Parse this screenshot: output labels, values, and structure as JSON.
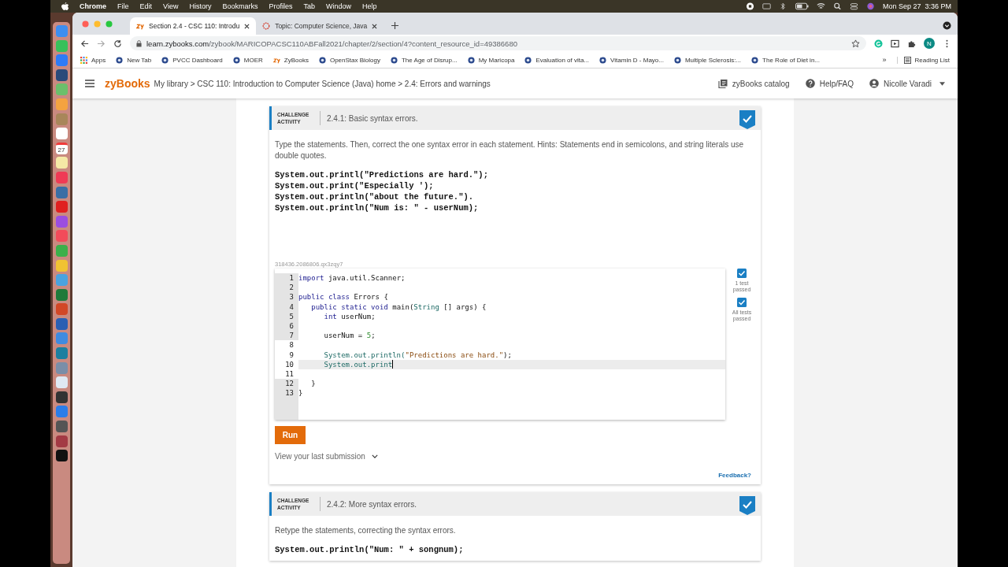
{
  "menubar": {
    "app": "Chrome",
    "menus": [
      "File",
      "Edit",
      "View",
      "History",
      "Bookmarks",
      "Profiles",
      "Tab",
      "Window",
      "Help"
    ],
    "clock": "Mon Sep 27  3:36 PM"
  },
  "dock": {
    "calendar_day": "27"
  },
  "tabs": [
    {
      "title": "Section 2.4 - CSC 110: Introdu",
      "selected": true,
      "kind": "zybooks"
    },
    {
      "title": "Topic: Computer Science, Java",
      "selected": false,
      "kind": "canvas"
    }
  ],
  "address": {
    "host": "learn.zybooks.com",
    "path": "/zybook/MARICOPACSC110ABFall2021/chapter/2/section/4?content_resource_id=49386680"
  },
  "profile": "N",
  "bookmarks": [
    {
      "label": "Apps",
      "kind": "apps"
    },
    {
      "label": "New Tab",
      "kind": "site"
    },
    {
      "label": "PVCC Dashboard",
      "kind": "site"
    },
    {
      "label": "MOER",
      "kind": "site"
    },
    {
      "label": "ZyBooks",
      "kind": "zy"
    },
    {
      "label": "OpenStax Biology",
      "kind": "site"
    },
    {
      "label": "The Age of Disrup...",
      "kind": "site"
    },
    {
      "label": "My Maricopa",
      "kind": "site"
    },
    {
      "label": "Evaluation of vita...",
      "kind": "site"
    },
    {
      "label": "Vitamin D - Mayo...",
      "kind": "site"
    },
    {
      "label": "Multiple Sclerosis:...",
      "kind": "site"
    },
    {
      "label": "The Role of Diet in...",
      "kind": "site"
    }
  ],
  "bookmarks_more": "»",
  "reading_list": "Reading List",
  "header": {
    "logo": "zyBooks",
    "breadcrumb": "My library > CSC 110: Introduction to Computer Science (Java) home > 2.4: Errors and warnings",
    "catalog": "zyBooks catalog",
    "help": "Help/FAQ",
    "user": "Nicolle Varadi"
  },
  "activities": [
    {
      "label": "CHALLENGE ACTIVITY",
      "title": "2.4.1: Basic syntax errors.",
      "completed": true,
      "instructions": "Type the statements. Then, correct the one syntax error in each statement. Hints: Statements end in semicolons, and string literals use double quotes.",
      "statements": [
        "System.out.printl(\"Predictions are hard.\");",
        "System.out.print(\"Especially ');",
        "System.out.println(\"about the future.\").",
        "System.out.println(\"Num is: \" - userNum);"
      ],
      "editor": {
        "id": "318436.2086806.qx3zqy7",
        "lines": [
          {
            "number": "1",
            "editable": false,
            "active": false,
            "segments": [
              {
                "text": "import",
                "kind": "keyword"
              },
              {
                "text": " java.util.Scanner;",
                "kind": "plain"
              }
            ]
          },
          {
            "number": "2",
            "editable": false,
            "active": false
          },
          {
            "number": "3",
            "editable": false,
            "active": false,
            "segments": [
              {
                "text": "public class",
                "kind": "keyword"
              },
              {
                "text": " Errors {",
                "kind": "plain"
              }
            ]
          },
          {
            "number": "4",
            "editable": false,
            "active": false,
            "segments": [
              {
                "text": "   public static void",
                "kind": "keyword"
              },
              {
                "text": " main(",
                "kind": "plain"
              },
              {
                "text": "String",
                "kind": "type"
              },
              {
                "text": " [] args) {",
                "kind": "plain"
              }
            ]
          },
          {
            "number": "5",
            "editable": false,
            "active": false,
            "segments": [
              {
                "text": "      int",
                "kind": "keyword"
              },
              {
                "text": " userNum;",
                "kind": "plain"
              }
            ]
          },
          {
            "number": "6",
            "editable": false,
            "active": false
          },
          {
            "number": "7",
            "editable": false,
            "active": false,
            "segments": [
              {
                "text": "      userNum = ",
                "kind": "plain"
              },
              {
                "text": "5",
                "kind": "number"
              },
              {
                "text": ";",
                "kind": "plain"
              }
            ]
          },
          {
            "number": "8",
            "editable": true,
            "active": false
          },
          {
            "number": "9",
            "editable": true,
            "active": false,
            "segments": [
              {
                "text": "      System.out.println(",
                "kind": "type"
              },
              {
                "text": "\"Predictions are hard.\"",
                "kind": "string"
              },
              {
                "text": ");",
                "kind": "plain"
              }
            ]
          },
          {
            "number": "10",
            "editable": true,
            "active": true,
            "segments": [
              {
                "text": "      System.out.print",
                "kind": "type"
              }
            ]
          },
          {
            "number": "11",
            "editable": true,
            "active": false
          },
          {
            "number": "12",
            "editable": false,
            "active": false,
            "segments": [
              {
                "text": "   }",
                "kind": "plain"
              }
            ]
          },
          {
            "number": "13",
            "editable": false,
            "active": false,
            "segments": [
              {
                "text": "}",
                "kind": "plain"
              }
            ]
          }
        ]
      },
      "tests": [
        {
          "label": "1 test passed",
          "passed": true
        },
        {
          "label": "All tests passed",
          "passed": true
        }
      ],
      "run": "Run",
      "submission": "View your last submission",
      "feedback": "Feedback?"
    },
    {
      "label": "CHALLENGE ACTIVITY",
      "title": "2.4.2: More syntax errors.",
      "completed": true,
      "instructions": "Retype the statements, correcting the syntax errors.",
      "statements": [
        "System.out.println(\"Num: \" + songnum);"
      ]
    }
  ]
}
